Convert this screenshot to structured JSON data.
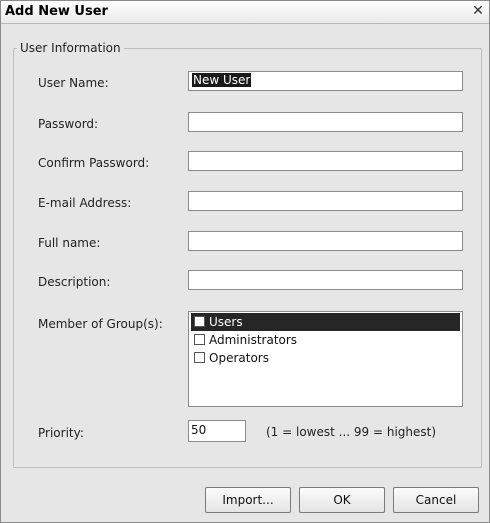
{
  "window": {
    "title": "Add New User",
    "close_glyph": "✕"
  },
  "group": {
    "legend": "User Information"
  },
  "form": {
    "username_label": "User Name:",
    "username_value": "New User",
    "password_label": "Password:",
    "password_value": "",
    "confirm_label": "Confirm Password:",
    "confirm_value": "",
    "email_label": "E-mail Address:",
    "email_value": "",
    "fullname_label": "Full name:",
    "fullname_value": "",
    "description_label": "Description:",
    "description_value": "",
    "groups_label": "Member of Group(s):",
    "groups": [
      {
        "label": "Users",
        "checked": false,
        "selected": true
      },
      {
        "label": "Administrators",
        "checked": false,
        "selected": false
      },
      {
        "label": "Operators",
        "checked": false,
        "selected": false
      }
    ],
    "priority_label": "Priority:",
    "priority_value": "50",
    "priority_hint": "(1 = lowest ... 99 = highest)"
  },
  "buttons": {
    "import": "Import...",
    "ok": "OK",
    "cancel": "Cancel"
  },
  "icons": {
    "close": "close-icon",
    "checkbox": "checkbox-icon"
  }
}
